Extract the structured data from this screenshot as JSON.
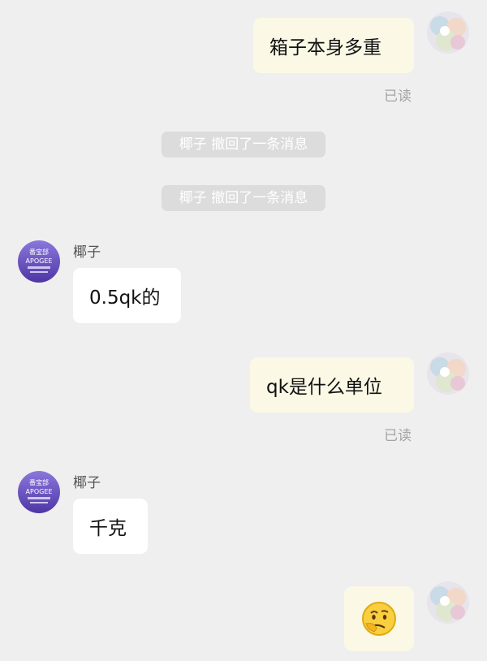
{
  "messages": {
    "m1": {
      "text": "箱子本身多重",
      "status": "已读"
    },
    "recall1": {
      "text": "椰子 撤回了一条消息"
    },
    "recall2": {
      "text": "椰子 撤回了一条消息"
    },
    "m4": {
      "sender": "椰子",
      "text": "0.5qk的"
    },
    "m5": {
      "text": "qk是什么单位",
      "status": "已读"
    },
    "m6": {
      "sender": "椰子",
      "text": "千克"
    },
    "m7": {
      "emoji": "thinking-face"
    }
  },
  "avatars": {
    "contact": {
      "line1": "番宝部",
      "line2": "APOGEE",
      "icon": "apogee-logo"
    },
    "self": {
      "icon": "pastel-anime-avatar"
    }
  },
  "colors": {
    "background": "#efefef",
    "outgoing_bubble": "#fbf8e6",
    "incoming_bubble": "#ffffff",
    "system_bubble": "#dcdcdc",
    "contact_avatar": "#6f58c9"
  }
}
